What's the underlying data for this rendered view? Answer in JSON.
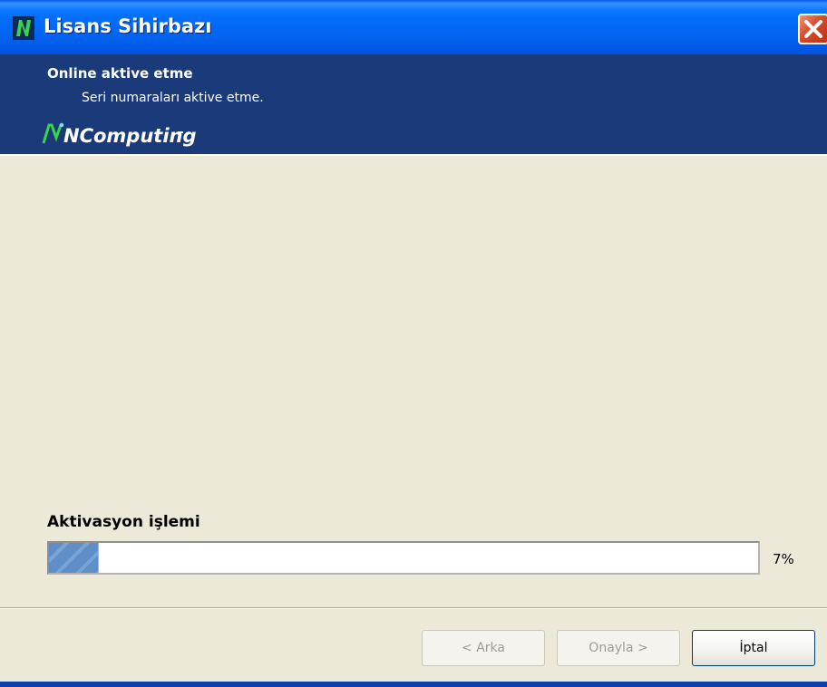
{
  "window": {
    "title": "Lisans Sihirbazı",
    "icon": "ncomputing-icon",
    "close_icon": "close-icon"
  },
  "header": {
    "title": "Online aktive etme",
    "subtitle": "Seri numaraları aktive etme.",
    "logo_text": "NComputing"
  },
  "progress": {
    "label": "Aktivasyon işlemi",
    "value_percent": 7,
    "display": "7%"
  },
  "buttons": {
    "back": "< Arka",
    "confirm": "Onayla >",
    "cancel": "İptal"
  },
  "colors": {
    "titlebar": "#0054e3",
    "header_band": "#1a3a7a",
    "logo_green": "#39b54a",
    "dialog_bg": "#ece9d8",
    "progress_fill": "#5f8ec8"
  }
}
